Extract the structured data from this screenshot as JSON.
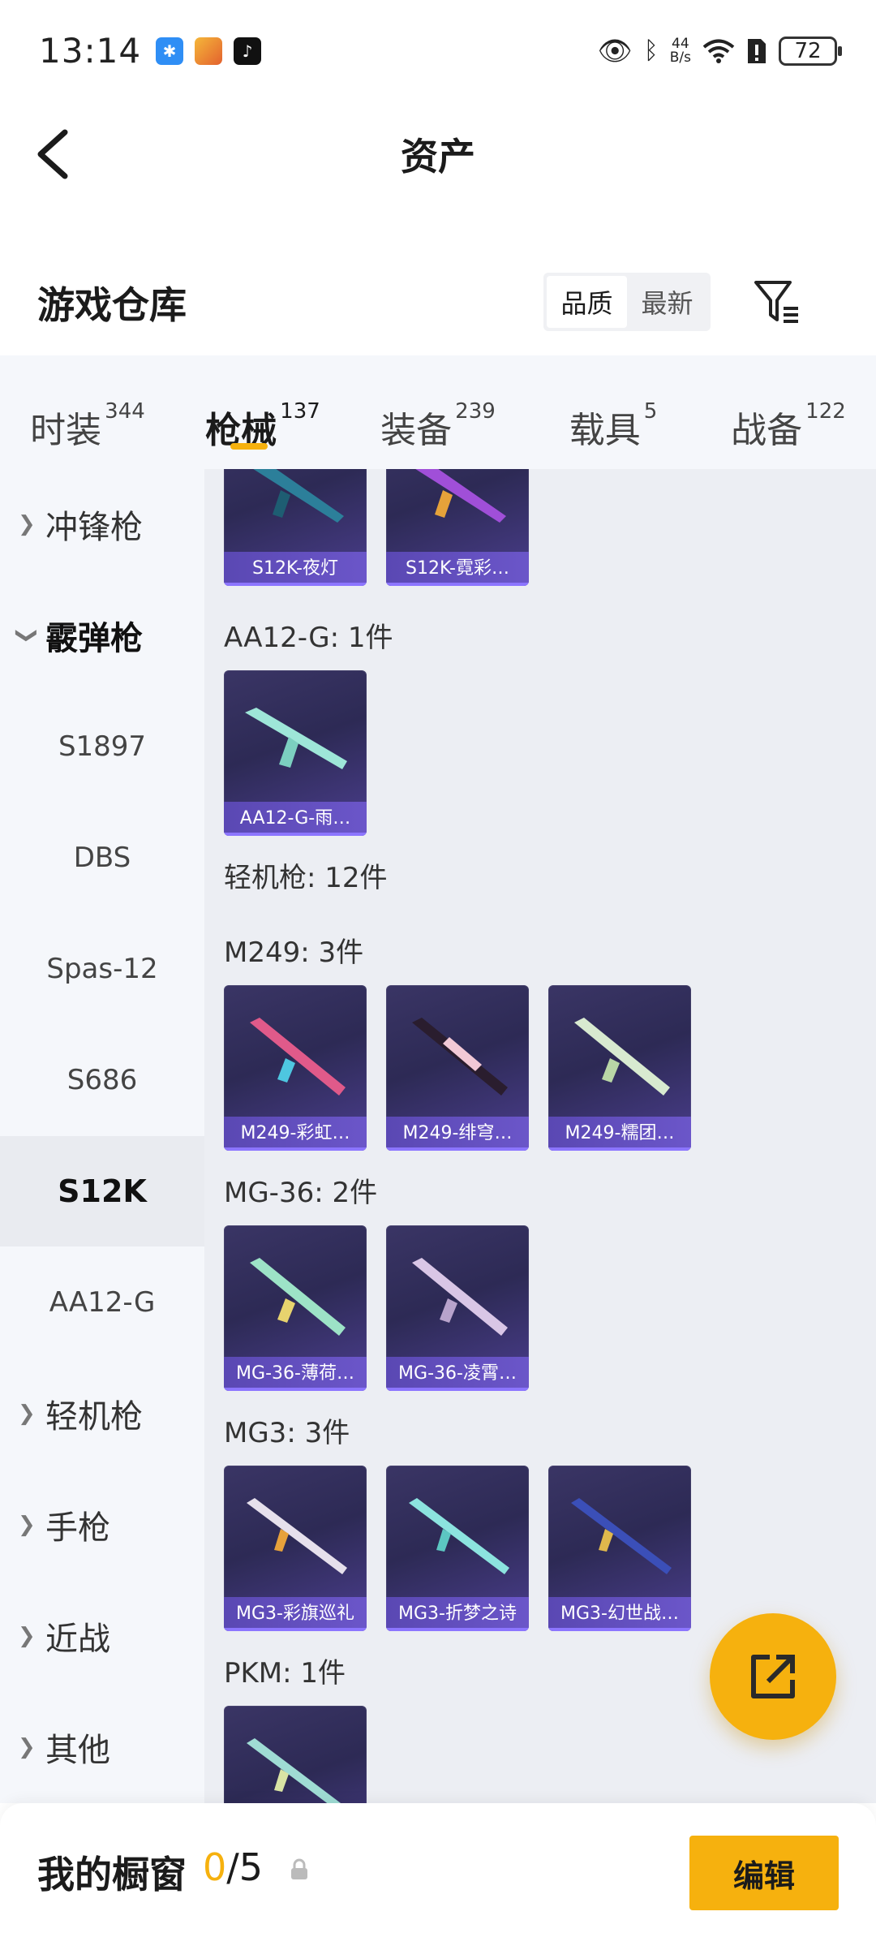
{
  "status_bar": {
    "time": "13:14",
    "net_speed_value": "44",
    "net_speed_unit": "B/s",
    "battery": "72"
  },
  "header": {
    "title": "资产"
  },
  "warehouse": {
    "title": "游戏仓库",
    "sort_options": [
      "品质",
      "最新"
    ],
    "sort_selected": "品质"
  },
  "tabs": [
    {
      "label": "时装",
      "count": "344"
    },
    {
      "label": "枪械",
      "count": "137"
    },
    {
      "label": "装备",
      "count": "239"
    },
    {
      "label": "载具",
      "count": "5"
    },
    {
      "label": "战备",
      "count": "122"
    }
  ],
  "active_tab": "枪械",
  "sidebar": [
    {
      "label": "冲锋枪",
      "type": "category",
      "chevron": "right"
    },
    {
      "label": "霰弹枪",
      "type": "category",
      "chevron": "down"
    },
    {
      "label": "S1897",
      "type": "sub"
    },
    {
      "label": "DBS",
      "type": "sub"
    },
    {
      "label": "Spas-12",
      "type": "sub"
    },
    {
      "label": "S686",
      "type": "sub"
    },
    {
      "label": "S12K",
      "type": "sub",
      "selected": true
    },
    {
      "label": "AA12-G",
      "type": "sub"
    },
    {
      "label": "轻机枪",
      "type": "category",
      "chevron": "right"
    },
    {
      "label": "手枪",
      "type": "category",
      "chevron": "right"
    },
    {
      "label": "近战",
      "type": "category",
      "chevron": "right"
    },
    {
      "label": "其他",
      "type": "category",
      "chevron": "right"
    }
  ],
  "content": {
    "s12k_cards": [
      {
        "name": "S12K-夜灯"
      },
      {
        "name": "S12K-霓彩…"
      }
    ],
    "sections": [
      {
        "label": "AA12-G: 1件",
        "cards": [
          {
            "name": "AA12-G-雨…"
          }
        ]
      },
      {
        "label": "轻机枪: 12件"
      },
      {
        "label": "M249: 3件",
        "cards": [
          {
            "name": "M249-彩虹…"
          },
          {
            "name": "M249-绯穹…"
          },
          {
            "name": "M249-糯团…"
          }
        ]
      },
      {
        "label": "MG-36: 2件",
        "cards": [
          {
            "name": "MG-36-薄荷…"
          },
          {
            "name": "MG-36-凌霄…"
          }
        ]
      },
      {
        "label": "MG3: 3件",
        "cards": [
          {
            "name": "MG3-彩旗巡礼"
          },
          {
            "name": "MG3-折梦之诗"
          },
          {
            "name": "MG3-幻世战…"
          }
        ]
      },
      {
        "label": "PKM: 1件",
        "cards": [
          {
            "name": ""
          }
        ]
      }
    ]
  },
  "bottom_bar": {
    "title": "我的橱窗",
    "current": "0",
    "total": "/5",
    "edit_label": "编辑"
  },
  "colors": {
    "accent": "#f6b10e",
    "card_bg": "#2d2a55",
    "card_label": "#5a48b3",
    "sidebar_bg": "#f5f7fb",
    "content_bg": "#eceef3"
  }
}
